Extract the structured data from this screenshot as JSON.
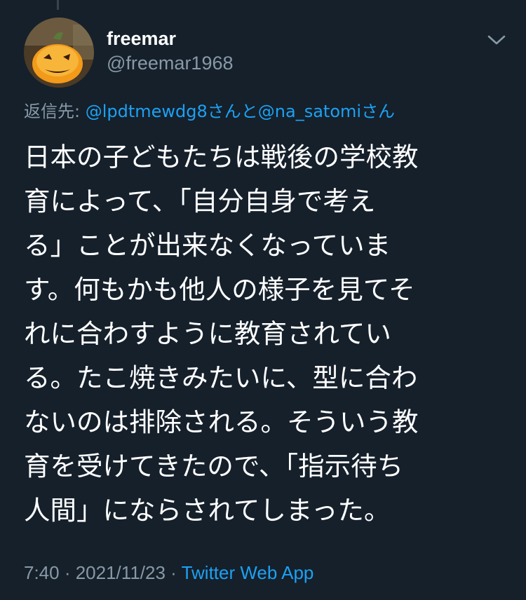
{
  "tweet": {
    "author": {
      "display_name": "freemar",
      "handle": "@freemar1968",
      "avatar_icon": "pumpkin-avatar"
    },
    "menu_icon": "chevron-down-icon",
    "reply": {
      "prefix": "返信先: ",
      "mention_1": "@lpdtmewdg8",
      "joiner": "さんと",
      "mention_2": "@na_satomi",
      "suffix": "さん"
    },
    "text_lines": [
      "日本の子どもたちは戦後の学校教",
      "育によって、「自分自身で考え",
      "る」ことが出来なくなっていま",
      "す。何もかも他人の様子を見てそ",
      "れに合わすように教育されてい",
      "る。たこ焼きみたいに、型に合わ",
      "ないのは排除される。そういう教",
      "育を受けてきたので、「指示待ち",
      "人間」にならされてしまった。"
    ],
    "meta": {
      "time": "7:40",
      "separator": " · ",
      "date": "2021/11/23",
      "separator_2": " · ",
      "source": "Twitter Web App"
    }
  },
  "colors": {
    "background": "#15202b",
    "text": "#ffffff",
    "secondary": "#8899a6",
    "link": "#1da1f2"
  }
}
